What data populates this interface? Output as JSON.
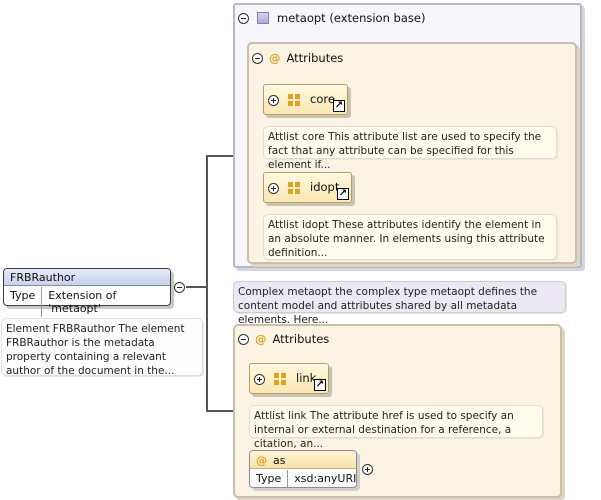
{
  "element": {
    "name": "FRBRauthor",
    "type_key": "Type",
    "type_value": "Extension of 'metaopt'",
    "documentation": "Element FRBRauthor The element FRBRauthor is the metadata property containing a relevant author of the document in the..."
  },
  "extension_base": {
    "label": "metaopt (extension base)",
    "documentation": "Complex metaopt the complex type metaopt defines the content model and attributes shared by all metadata elements. Here..."
  },
  "base_attributes": {
    "label": "Attributes",
    "groups": [
      {
        "name": "core",
        "documentation": "Attlist core This attribute list are used to specify the fact that any attribute can be specified for this element if..."
      },
      {
        "name": "idopt",
        "documentation": "Attlist idopt These attributes identify the element in an absolute manner. In elements using this attribute definition..."
      }
    ]
  },
  "own_attributes": {
    "label": "Attributes",
    "group": {
      "name": "link",
      "documentation": "Attlist link The attribute href is used to specify an internal or external destination for a reference, a citation, an..."
    },
    "attribute": {
      "name": "as",
      "type_key": "Type",
      "type_value": "xsd:anyURI"
    }
  },
  "icons": {
    "collapse": "minus-circle-icon",
    "expand": "plus-circle-icon",
    "complex_type": "purple-square-icon",
    "attribute": "at-sign-icon",
    "attribute_group": "four-squares-icon",
    "reference": "shortcut-arrow-icon"
  },
  "colors": {
    "accent_orange": "#e0a020",
    "element_header": "#c7d3ea",
    "complex_type_purple": "#b6a9d8"
  }
}
